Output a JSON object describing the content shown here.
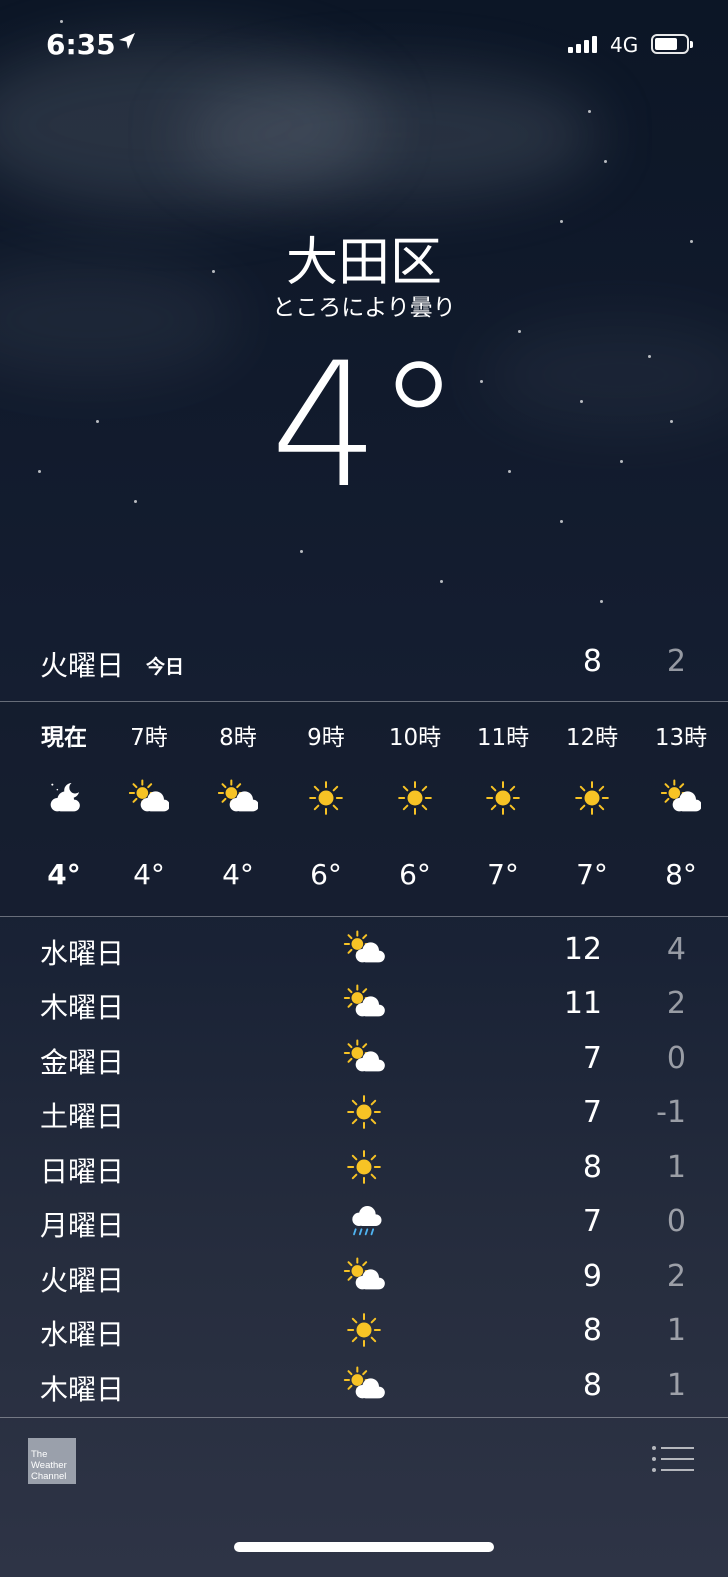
{
  "status_bar": {
    "time": "6:35",
    "network": "4G"
  },
  "location": {
    "city": "大田区",
    "condition": "ところにより曇り",
    "temperature": "4°"
  },
  "today": {
    "day": "火曜日",
    "label": "今日",
    "high": "8",
    "low": "2"
  },
  "hourly": [
    {
      "hour": "現在",
      "icon": "moon-cloud-icon",
      "temp": "4°"
    },
    {
      "hour": "7時",
      "icon": "sun-cloud-icon",
      "temp": "4°"
    },
    {
      "hour": "8時",
      "icon": "sun-cloud-icon",
      "temp": "4°"
    },
    {
      "hour": "9時",
      "icon": "sun-icon",
      "temp": "6°"
    },
    {
      "hour": "10時",
      "icon": "sun-icon",
      "temp": "6°"
    },
    {
      "hour": "11時",
      "icon": "sun-icon",
      "temp": "7°"
    },
    {
      "hour": "12時",
      "icon": "sun-icon",
      "temp": "7°"
    },
    {
      "hour": "13時",
      "icon": "sun-cloud-icon",
      "temp": "8°"
    }
  ],
  "daily": [
    {
      "day": "水曜日",
      "icon": "sun-cloud-icon",
      "high": "12",
      "low": "4"
    },
    {
      "day": "木曜日",
      "icon": "sun-cloud-icon",
      "high": "11",
      "low": "2"
    },
    {
      "day": "金曜日",
      "icon": "sun-cloud-icon",
      "high": "7",
      "low": "0"
    },
    {
      "day": "土曜日",
      "icon": "sun-icon",
      "high": "7",
      "low": "-1"
    },
    {
      "day": "日曜日",
      "icon": "sun-icon",
      "high": "8",
      "low": "1"
    },
    {
      "day": "月曜日",
      "icon": "rain-cloud-icon",
      "high": "7",
      "low": "0"
    },
    {
      "day": "火曜日",
      "icon": "sun-cloud-icon",
      "high": "9",
      "low": "2"
    },
    {
      "day": "水曜日",
      "icon": "sun-icon",
      "high": "8",
      "low": "1"
    },
    {
      "day": "木曜日",
      "icon": "sun-cloud-icon",
      "high": "8",
      "low": "1"
    }
  ],
  "footer": {
    "logo_text": "The Weather Channel"
  },
  "colors": {
    "sun": "#f7c325",
    "cloud": "#ffffff",
    "rain": "#4fb3f0"
  }
}
